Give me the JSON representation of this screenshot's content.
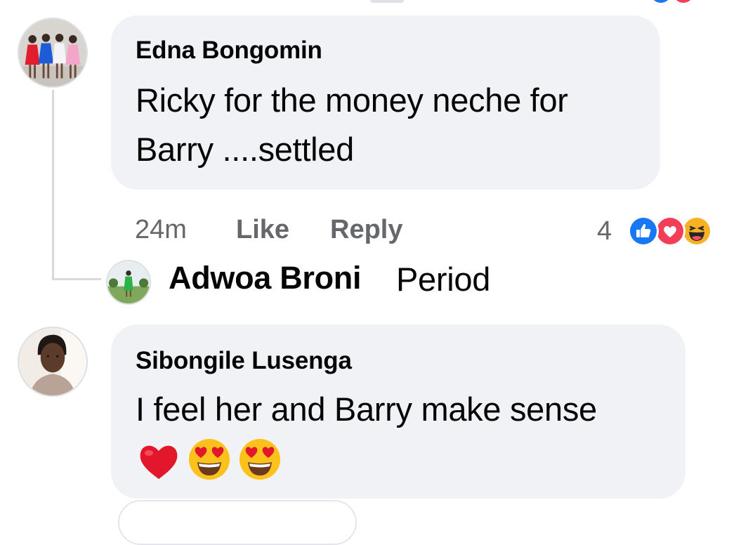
{
  "comments": [
    {
      "author": "Edna Bongomin",
      "line1": "Ricky for the money neche for",
      "line2": "Barry ....settled",
      "time": "24m",
      "like_label": "Like",
      "reply_label": "Reply",
      "reaction_count": "4",
      "reactions": [
        "like-icon",
        "love-icon",
        "haha-icon"
      ]
    },
    {
      "author": "Sibongile Lusenga",
      "line1": "I feel her and Barry make sense",
      "emojis": [
        "red-heart-emoji",
        "heart-eyes-emoji",
        "heart-eyes-emoji"
      ]
    }
  ],
  "reply": {
    "author": "Adwoa Broni",
    "text": "Period"
  },
  "colors": {
    "bubble": "#f0f2f5",
    "meta_text": "#65676b",
    "like_blue": "#1877f2",
    "love_red": "#f33e58",
    "haha_yellow": "#f7b125"
  }
}
